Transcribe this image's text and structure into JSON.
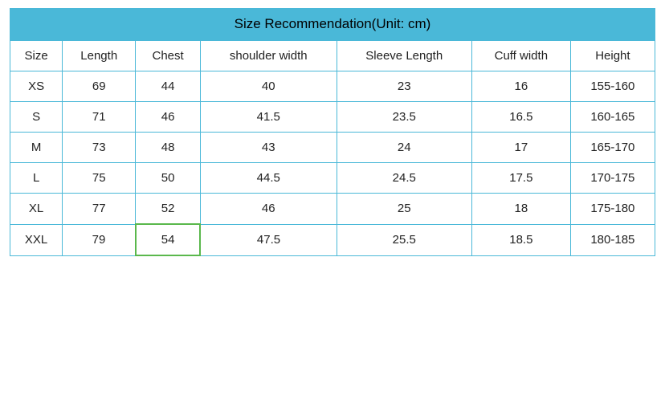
{
  "title": "Size Recommendation(Unit: cm)",
  "columns": [
    "Size",
    "Length",
    "Chest",
    "shoulder width",
    "Sleeve Length",
    "Cuff width",
    "Height"
  ],
  "rows": [
    {
      "size": "XS",
      "length": "69",
      "chest": "44",
      "shoulder_width": "40",
      "sleeve_length": "23",
      "cuff_width": "16",
      "height": "155-160"
    },
    {
      "size": "S",
      "length": "71",
      "chest": "46",
      "shoulder_width": "41.5",
      "sleeve_length": "23.5",
      "cuff_width": "16.5",
      "height": "160-165"
    },
    {
      "size": "M",
      "length": "73",
      "chest": "48",
      "shoulder_width": "43",
      "sleeve_length": "24",
      "cuff_width": "17",
      "height": "165-170"
    },
    {
      "size": "L",
      "length": "75",
      "chest": "50",
      "shoulder_width": "44.5",
      "sleeve_length": "24.5",
      "cuff_width": "17.5",
      "height": "170-175"
    },
    {
      "size": "XL",
      "length": "77",
      "chest": "52",
      "shoulder_width": "46",
      "sleeve_length": "25",
      "cuff_width": "18",
      "height": "175-180"
    },
    {
      "size": "XXL",
      "length": "79",
      "chest": "54",
      "shoulder_width": "47.5",
      "sleeve_length": "25.5",
      "cuff_width": "18.5",
      "height": "180-185"
    }
  ],
  "highlight": {
    "row": 5,
    "col": 2
  }
}
